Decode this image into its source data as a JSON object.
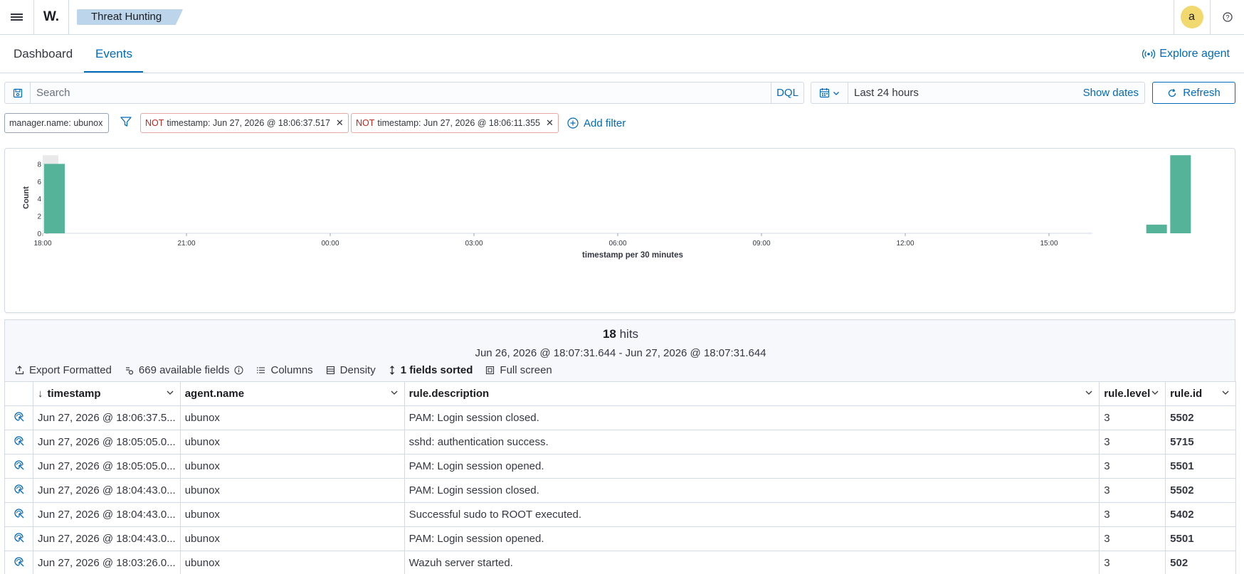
{
  "header": {
    "logo_text": "W.",
    "breadcrumb": "Threat Hunting",
    "avatar_initial": "a"
  },
  "tabs": [
    {
      "label": "Dashboard",
      "active": false
    },
    {
      "label": "Events",
      "active": true
    }
  ],
  "explore_agent_label": "Explore agent",
  "query": {
    "placeholder": "Search",
    "language": "DQL",
    "date_range": "Last 24 hours",
    "show_dates_label": "Show dates",
    "refresh_label": "Refresh"
  },
  "filters": {
    "pinned": "manager.name: ubunox",
    "pills": [
      {
        "not_label": "NOT",
        "text": "timestamp: Jun 27, 2026 @ 18:06:37.517"
      },
      {
        "not_label": "NOT",
        "text": "timestamp: Jun 27, 2026 @ 18:06:11.355"
      }
    ],
    "add_filter_label": "Add filter"
  },
  "chart_data": {
    "type": "bar",
    "ylabel": "Count",
    "xlabel": "timestamp per 30 minutes",
    "yticks": [
      "0",
      "2",
      "4",
      "6",
      "8"
    ],
    "ylim": [
      0,
      9
    ],
    "xticks": [
      "21:00",
      "00:00",
      "03:00",
      "06:00",
      "09:00",
      "12:00",
      "15:00",
      "18:00"
    ],
    "bars": [
      {
        "x": "17:00",
        "value": 1
      },
      {
        "x": "17:30",
        "value": 9
      },
      {
        "x": "18:00",
        "value": 8
      }
    ],
    "bar_color": "#54b399"
  },
  "results": {
    "hits_count": "18",
    "hits_label": "hits",
    "range": "Jun 26, 2026 @ 18:07:31.644 - Jun 27, 2026 @ 18:07:31.644",
    "toolbar": {
      "export": "Export Formatted",
      "fields": "669 available fields",
      "columns": "Columns",
      "density": "Density",
      "sorted": "1 fields sorted",
      "fullscreen": "Full screen"
    },
    "columns": [
      "timestamp",
      "agent.name",
      "rule.description",
      "rule.level",
      "rule.id"
    ],
    "rows": [
      {
        "timestamp": "Jun 27, 2026 @ 18:06:37.5...",
        "agent": "ubunox",
        "description": "PAM: Login session closed.",
        "level": "3",
        "id": "5502"
      },
      {
        "timestamp": "Jun 27, 2026 @ 18:05:05.0...",
        "agent": "ubunox",
        "description": "sshd: authentication success.",
        "level": "3",
        "id": "5715"
      },
      {
        "timestamp": "Jun 27, 2026 @ 18:05:05.0...",
        "agent": "ubunox",
        "description": "PAM: Login session opened.",
        "level": "3",
        "id": "5501"
      },
      {
        "timestamp": "Jun 27, 2026 @ 18:04:43.0...",
        "agent": "ubunox",
        "description": "PAM: Login session closed.",
        "level": "3",
        "id": "5502"
      },
      {
        "timestamp": "Jun 27, 2026 @ 18:04:43.0...",
        "agent": "ubunox",
        "description": "Successful sudo to ROOT executed.",
        "level": "3",
        "id": "5402"
      },
      {
        "timestamp": "Jun 27, 2026 @ 18:04:43.0...",
        "agent": "ubunox",
        "description": "PAM: Login session opened.",
        "level": "3",
        "id": "5501"
      },
      {
        "timestamp": "Jun 27, 2026 @ 18:03:26.0...",
        "agent": "ubunox",
        "description": "Wazuh server started.",
        "level": "3",
        "id": "502"
      }
    ]
  }
}
